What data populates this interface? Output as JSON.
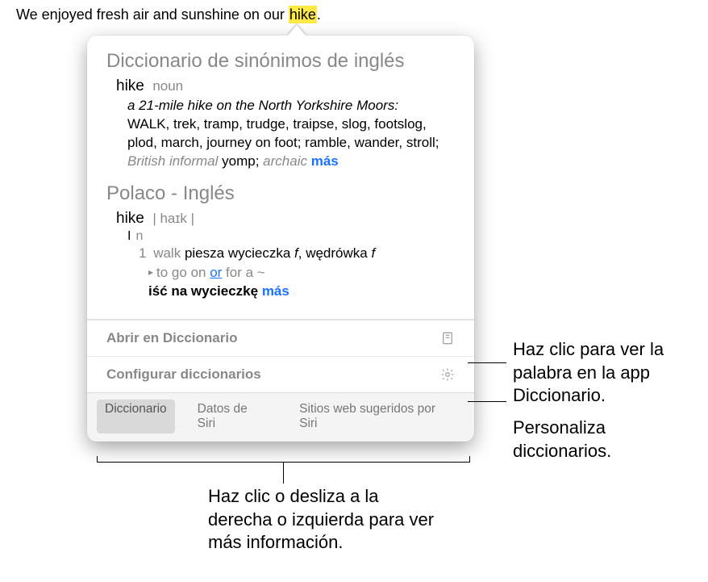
{
  "sentence": {
    "prefix": "We enjoyed fresh air and sunshine on our ",
    "highlight": "hike",
    "suffix": "."
  },
  "thesaurus": {
    "title": "Diccionario de sinónimos de inglés",
    "word": "hike",
    "pos": "noun",
    "example": "a 21-mile hike on the North Yorkshire Moors:",
    "head_syn": "WALK",
    "synonyms": ", trek, tramp, trudge, traipse, slog, footslog, plod, march, journey on foot; ramble, wander, stroll; ",
    "label1": "British informal",
    "label1_word": " yomp; ",
    "label2": "archaic",
    "more": " más"
  },
  "bilingual": {
    "title": "Polaco - Inglés",
    "word": "hike",
    "pron": "| haɪk |",
    "roman": "I",
    "gram": "n",
    "sense_num": "1",
    "gloss": "walk",
    "trans1": " piesza wycieczka ",
    "g1": "f",
    "trans2": ", wędrówka ",
    "g2": "f",
    "phrase_pre": "to go on ",
    "phrase_or": "or",
    "phrase_post": " for a ~",
    "phrase_trans": "iść na wycieczkę",
    "more": " más"
  },
  "actions": {
    "open": "Abrir en Diccionario",
    "configure": "Configurar diccionarios"
  },
  "tabs": {
    "dict": "Diccionario",
    "siri": "Datos de Siri",
    "web": "Sitios web sugeridos por Siri"
  },
  "callouts": {
    "open": "Haz clic para ver la palabra en la app Diccionario.",
    "configure": "Personaliza diccionarios.",
    "tabs": "Haz clic o desliza a la derecha o izquierda para ver más información."
  }
}
